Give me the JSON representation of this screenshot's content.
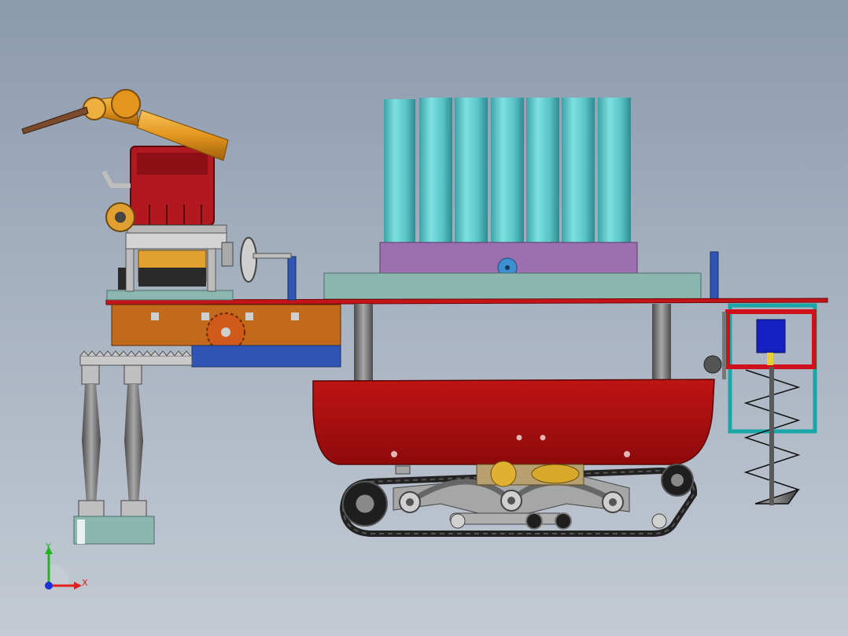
{
  "triad": {
    "y_label": "Y",
    "x_label": "X",
    "colors": {
      "y": "#1fb81f",
      "x": "#e02020",
      "z": "#1d2fd8"
    }
  },
  "colors": {
    "cylinders": "#5fc8c8",
    "purple_plate": "#9b6fb0",
    "hull": "#a80d0d",
    "red_bar": "#c4141a",
    "orange_box": "#c16a1c",
    "blue_plate": "#2f56b4",
    "teal_plate": "#8bb7ae",
    "engine_red": "#b11820",
    "robot_arm": "#e3961e",
    "track": "#262626",
    "frame_cyan": "#1aa6a6",
    "frame_red": "#d0101a",
    "motor_blue": "#1420c0",
    "gear_orange": "#d05a1a"
  }
}
